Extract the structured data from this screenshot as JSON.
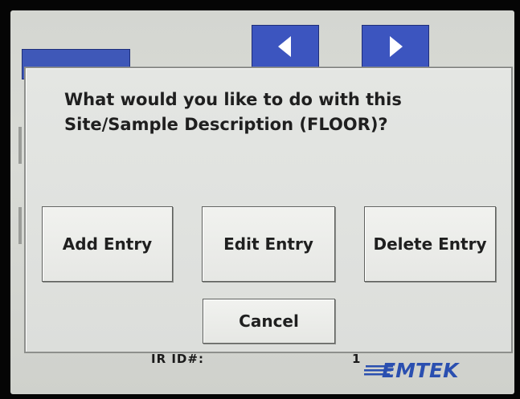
{
  "dialog": {
    "prompt_line1": "What would you like to do with this",
    "prompt_line2": "Site/Sample Description (FLOOR)?",
    "add_label": "Add Entry",
    "edit_label": "Edit Entry",
    "delete_label": "Delete Entry",
    "cancel_label": "Cancel"
  },
  "background": {
    "partial_text": "IR ID#:",
    "partial_value": "1",
    "brand": "EMTEK",
    "nav_prev_icon": "left-arrow-icon",
    "nav_next_icon": "right-arrow-icon"
  },
  "colors": {
    "nav_blue": "#3c55bf",
    "brand_blue": "#2a4fb0"
  }
}
